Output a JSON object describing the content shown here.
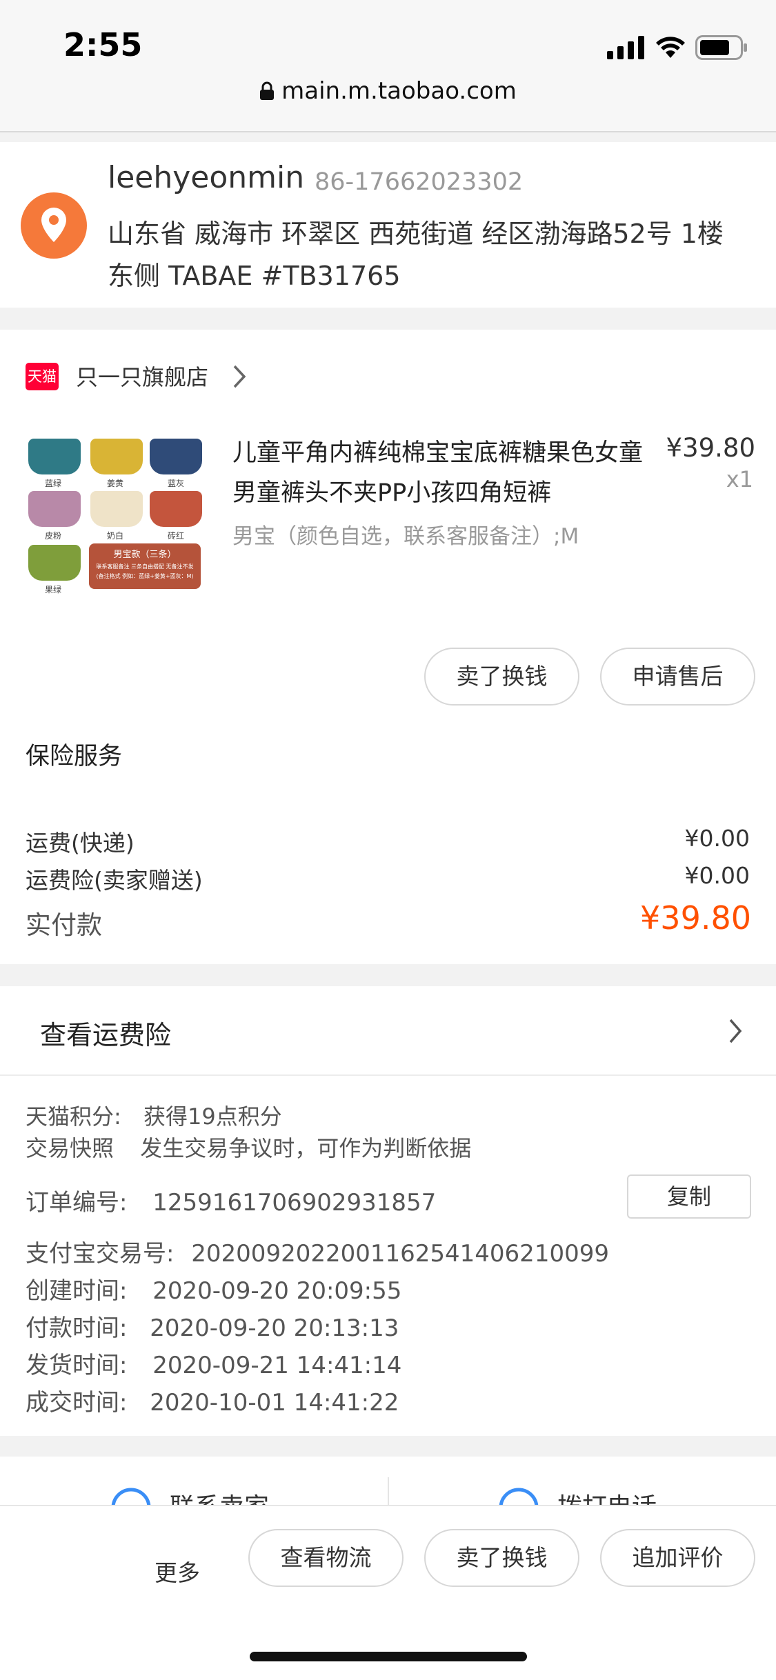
{
  "status_bar": {
    "time": "2:55",
    "url": "main.m.taobao.com"
  },
  "address": {
    "name": "leehyeonmin",
    "phone": "86-17662023302",
    "line1": "山东省 威海市 环翠区 西苑街道 经区渤海路52号 1楼",
    "line2": "东侧 TABAE #TB31765"
  },
  "shop": {
    "badge": "天猫",
    "name": "只一只旗舰店"
  },
  "product": {
    "title_line1": "儿童平角内裤纯棉宝宝底裤糖果色女童",
    "title_line2": "男童裤头不夹PP小孩四角短裤",
    "sku": "男宝（颜色自选，联系客服备注）;M",
    "price": "¥39.80",
    "qty": "x1",
    "thumb_labels": [
      "蓝绿",
      "姜黄",
      "蓝灰",
      "皮粉",
      "奶白",
      "砖红",
      "果绿"
    ],
    "thumb_card_title": "男宝款（三条）",
    "thumb_card_text": "联系客服备注 三条自由搭配 无备注不发",
    "thumb_card_text2": "(备注格式 例如：蓝绿+姜黄+蓝灰：M)"
  },
  "item_actions": {
    "sell": "卖了换钱",
    "after_sale": "申请售后"
  },
  "insurance": {
    "title": "保险服务"
  },
  "costs": {
    "shipping_label": "运费(快递)",
    "shipping_value": "¥0.00",
    "shipping_ins_label": "运费险(卖家赠送)",
    "shipping_ins_value": "¥0.00",
    "paid_label": "实付款",
    "paid_value": "¥39.80"
  },
  "view_insurance": {
    "label": "查看运费险"
  },
  "order_info": {
    "points_label": "天猫积分:",
    "points_value": "获得19点积分",
    "snapshot_label": "交易快照",
    "snapshot_value": "发生交易争议时，可作为判断依据",
    "order_no_label": "订单编号:",
    "order_no_value": "1259161706902931857",
    "copy_label": "复制",
    "alipay_label": "支付宝交易号:",
    "alipay_value": "2020092022001162541406210099",
    "created_label": "创建时间:",
    "created_value": "2020-09-20 20:09:55",
    "paid_label": "付款时间:",
    "paid_value": "2020-09-20 20:13:13",
    "shipped_label": "发货时间:",
    "shipped_value": "2020-09-21 14:41:14",
    "done_label": "成交时间:",
    "done_value": "2020-10-01 14:41:22"
  },
  "contact": {
    "seller": "联系卖家",
    "call": "拨打电话"
  },
  "bottom_bar": {
    "more": "更多",
    "logistics": "查看物流",
    "sell": "卖了换钱",
    "review": "追加评价"
  },
  "colors": {
    "accent": "#ff5000",
    "location_orange": "#f5793a",
    "tmall_red": "#ff0036"
  }
}
